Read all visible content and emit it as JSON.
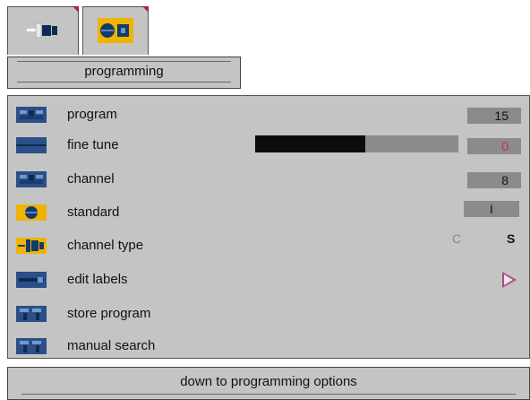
{
  "tabs": [
    {
      "icon": "channel-type-icon",
      "selected": false
    },
    {
      "icon": "standard-icon",
      "selected": true
    }
  ],
  "panel_title": "programming",
  "rows": [
    {
      "label": "program",
      "icon": "program-icon",
      "value": "15"
    },
    {
      "label": "fine tune",
      "icon": "fine-tune-icon",
      "value": "0",
      "fill": 0.54
    },
    {
      "label": "channel",
      "icon": "channel-icon",
      "value": "8"
    },
    {
      "label": "standard",
      "icon": "standard-icon",
      "value": "I"
    },
    {
      "label": "channel type",
      "icon": "channel-type-icon",
      "option_c": "C",
      "option_s": "S"
    },
    {
      "label": "edit labels",
      "icon": "edit-labels-icon",
      "arrow": "play-arrow-icon"
    },
    {
      "label": "store program",
      "icon": "store-program-icon"
    },
    {
      "label": "manual search",
      "icon": "manual-search-icon"
    }
  ],
  "footer": "down to programming options",
  "colors": {
    "panel": "#c4c4c4",
    "accent_yellow": "#f0b400",
    "icon_blue": "#2b4f86",
    "value_box": "#8b8b8b",
    "fine_tune_value": "#cc2b6a"
  }
}
